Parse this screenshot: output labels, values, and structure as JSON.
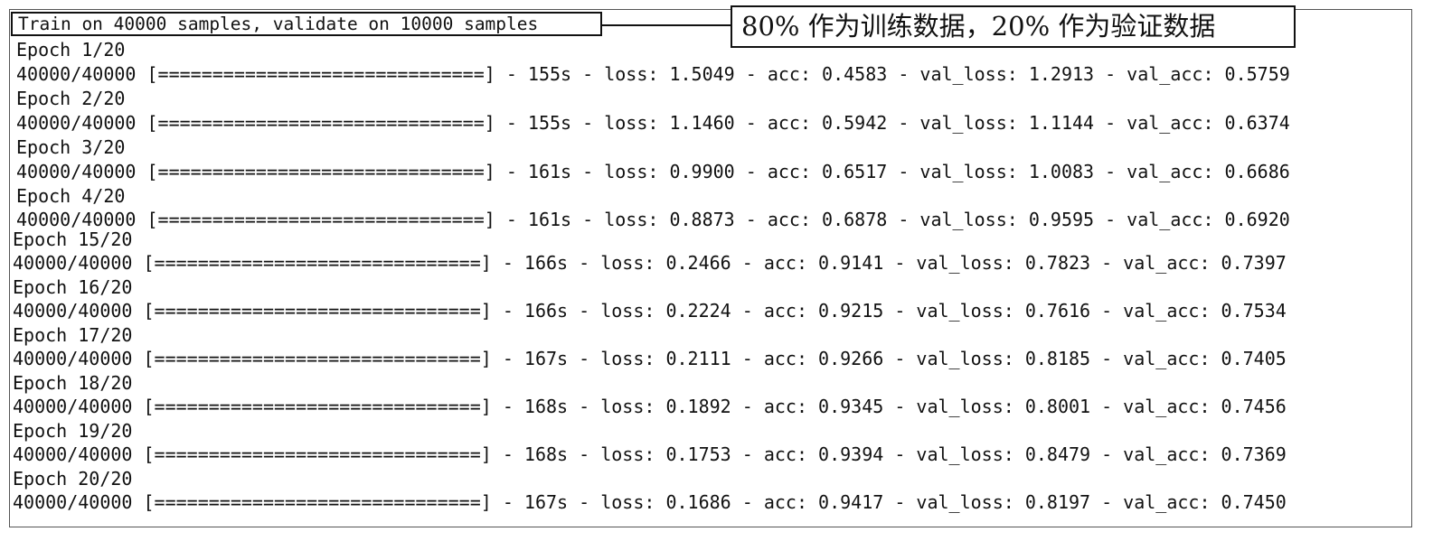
{
  "header_text": "Train on 40000 samples, validate on 10000 samples",
  "callout_text": "80% 作为训练数据，20% 作为验证数据",
  "lines_upper": [
    {
      "epoch": "Epoch 1/20",
      "progress": "40000/40000 [==============================] - 155s - loss: 1.5049 - acc: 0.4583 - val_loss: 1.2913 - val_acc: 0.5759"
    },
    {
      "epoch": "Epoch 2/20",
      "progress": "40000/40000 [==============================] - 155s - loss: 1.1460 - acc: 0.5942 - val_loss: 1.1144 - val_acc: 0.6374"
    },
    {
      "epoch": "Epoch 3/20",
      "progress": "40000/40000 [==============================] - 161s - loss: 0.9900 - acc: 0.6517 - val_loss: 1.0083 - val_acc: 0.6686"
    },
    {
      "epoch": "Epoch 4/20",
      "progress": "40000/40000 [==============================] - 161s - loss: 0.8873 - acc: 0.6878 - val_loss: 0.9595 - val_acc: 0.6920"
    }
  ],
  "lines_lower": [
    {
      "epoch": "Epoch 15/20",
      "progress": "40000/40000 [==============================] - 166s - loss: 0.2466 - acc: 0.9141 - val_loss: 0.7823 - val_acc: 0.7397"
    },
    {
      "epoch": "Epoch 16/20",
      "progress": "40000/40000 [==============================] - 166s - loss: 0.2224 - acc: 0.9215 - val_loss: 0.7616 - val_acc: 0.7534"
    },
    {
      "epoch": "Epoch 17/20",
      "progress": "40000/40000 [==============================] - 167s - loss: 0.2111 - acc: 0.9266 - val_loss: 0.8185 - val_acc: 0.7405"
    },
    {
      "epoch": "Epoch 18/20",
      "progress": "40000/40000 [==============================] - 168s - loss: 0.1892 - acc: 0.9345 - val_loss: 0.8001 - val_acc: 0.7456"
    },
    {
      "epoch": "Epoch 19/20",
      "progress": "40000/40000 [==============================] - 168s - loss: 0.1753 - acc: 0.9394 - val_loss: 0.8479 - val_acc: 0.7369"
    },
    {
      "epoch": "Epoch 20/20",
      "progress": "40000/40000 [==============================] - 167s - loss: 0.1686 - acc: 0.9417 - val_loss: 0.8197 - val_acc: 0.7450"
    }
  ]
}
